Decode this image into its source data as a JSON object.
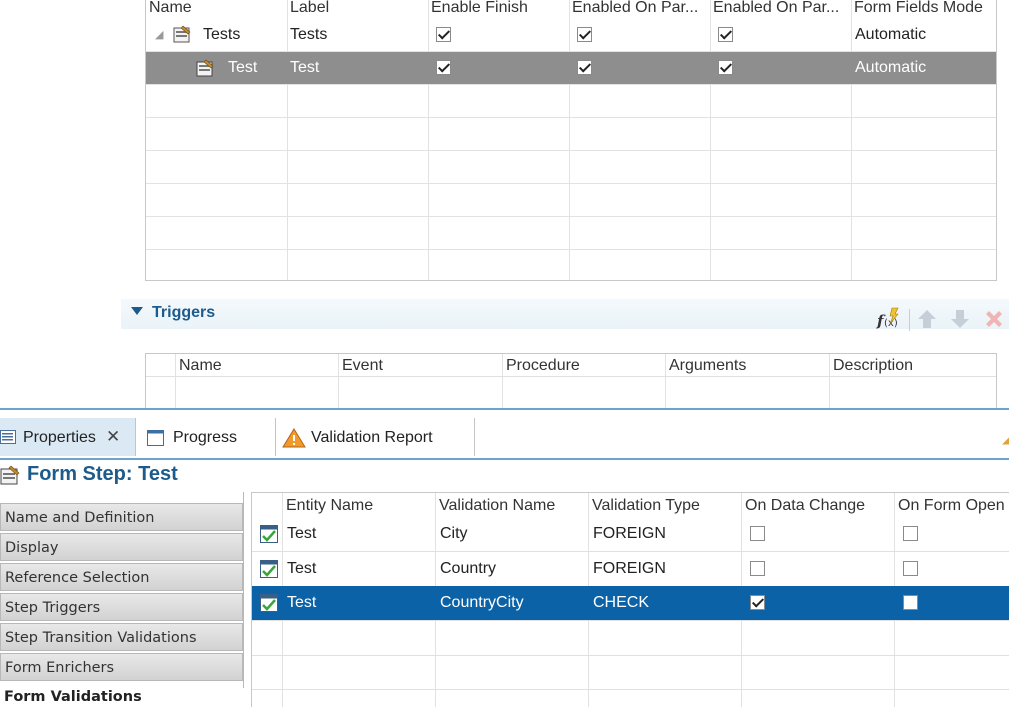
{
  "top_table": {
    "columns": [
      "Name",
      "Label",
      "Enable Finish",
      "Enabled On Par...",
      "Enabled On Par...",
      "Form Fields Mode"
    ],
    "rows": [
      {
        "name": "Tests",
        "label": "Tests",
        "enable_finish": true,
        "enabled_on_par_1": true,
        "enabled_on_par_2": true,
        "mode": "Automatic",
        "selected": false,
        "expanded": true
      },
      {
        "name": "Test",
        "label": "Test",
        "enable_finish": true,
        "enabled_on_par_1": true,
        "enabled_on_par_2": true,
        "mode": "Automatic",
        "selected": true
      }
    ]
  },
  "triggers": {
    "title": "Triggers",
    "toolbar": [
      "function-icon",
      "move-up-icon",
      "move-down-icon",
      "delete-icon"
    ],
    "columns": [
      "Name",
      "Event",
      "Procedure",
      "Arguments",
      "Description"
    ]
  },
  "panel": {
    "tabs": [
      {
        "label": "Properties",
        "icon": "properties-icon",
        "active": true
      },
      {
        "label": "Progress",
        "icon": "progress-icon"
      },
      {
        "label": "Validation Report",
        "icon": "warning-icon"
      }
    ],
    "title": "Form Step: Test",
    "nav_items": [
      "Name and Definition",
      "Display",
      "Reference Selection",
      "Step Triggers",
      "Step Transition Validations",
      "Form Enrichers",
      "Form Validations"
    ],
    "active_nav": "Form Validations"
  },
  "validations": {
    "columns": [
      "Entity Name",
      "Validation Name",
      "Validation Type",
      "On Data Change",
      "On Form Open"
    ],
    "rows": [
      {
        "entity": "Test",
        "name": "City",
        "type": "FOREIGN",
        "on_data_change": false,
        "on_form_open": false,
        "selected": false
      },
      {
        "entity": "Test",
        "name": "Country",
        "type": "FOREIGN",
        "on_data_change": false,
        "on_form_open": false,
        "selected": false
      },
      {
        "entity": "Test",
        "name": "CountryCity",
        "type": "CHECK",
        "on_data_change": true,
        "on_form_open": false,
        "selected": true
      }
    ]
  },
  "colors": {
    "accent": "#1d5b8c",
    "selection": "#0b62a7",
    "tree_selection": "#8e8e8e"
  }
}
